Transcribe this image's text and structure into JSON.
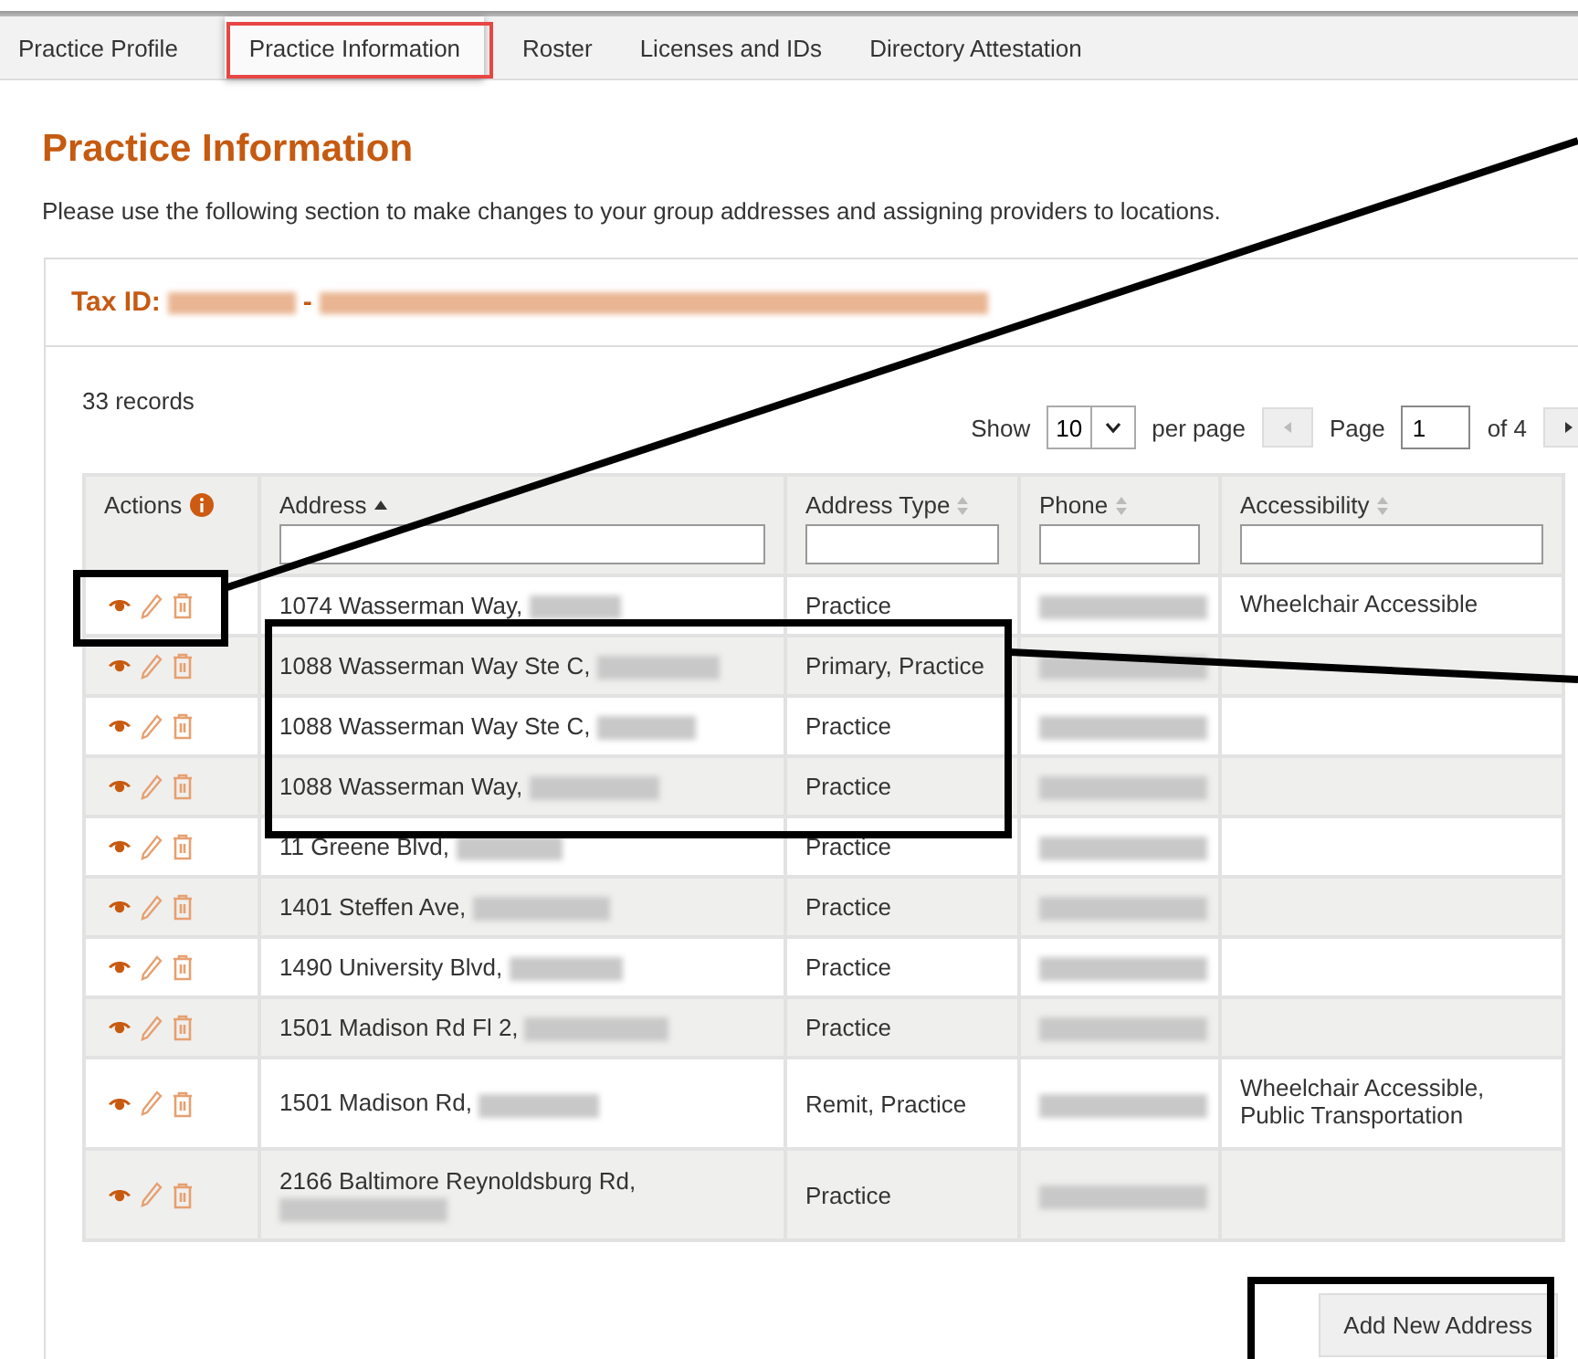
{
  "tabs": [
    {
      "label": "Practice Profile",
      "selected": false
    },
    {
      "label": "Practice Information",
      "selected": true
    },
    {
      "label": "Roster",
      "selected": false
    },
    {
      "label": "Licenses and IDs",
      "selected": false
    },
    {
      "label": "Directory Attestation",
      "selected": false
    }
  ],
  "heading": "Practice Information",
  "description": "Please use the following section to make changes to your group addresses and assigning providers to locations.",
  "card": {
    "tax_id_label": "Tax ID:",
    "separator": "-"
  },
  "records": "33 records",
  "pagination": {
    "show_label": "Show",
    "per_page_value": "10",
    "per_page_label": "per page",
    "page_label": "Page",
    "page_value": "1",
    "of_label": "of 4"
  },
  "table": {
    "columns": [
      {
        "label": "Actions",
        "kind": "info"
      },
      {
        "label": "Address",
        "kind": "sort",
        "sorted_ascending": true
      },
      {
        "label": "Address Type",
        "kind": "sort",
        "sorted_ascending": false
      },
      {
        "label": "Phone",
        "kind": "sort",
        "sorted_ascending": false
      },
      {
        "label": "Accessibility",
        "kind": "sort",
        "sorted_ascending": false
      }
    ],
    "rows": [
      {
        "address": "1074 Wasserman Way,",
        "type": "Practice",
        "accessibility": "Wheelchair Accessible"
      },
      {
        "address": "1088 Wasserman Way Ste C,",
        "type": "Primary, Practice"
      },
      {
        "address": "1088 Wasserman Way Ste C,",
        "type": "Practice"
      },
      {
        "address": "1088 Wasserman Way,",
        "type": "Practice"
      },
      {
        "address": "11 Greene Blvd,",
        "type": "Practice"
      },
      {
        "address": "1401 Steffen Ave,",
        "type": "Practice"
      },
      {
        "address": "1490 University Blvd,",
        "type": "Practice"
      },
      {
        "address": "1501 Madison Rd Fl 2,",
        "type": "Practice"
      },
      {
        "address": "1501 Madison Rd,",
        "type": "Remit, Practice",
        "accessibility": "Wheelchair Accessible, Public Transportation"
      },
      {
        "address": "2166 Baltimore Reynoldsburg Rd,",
        "type": "Practice",
        "wrap": true
      }
    ]
  },
  "add_button": "Add New Address"
}
